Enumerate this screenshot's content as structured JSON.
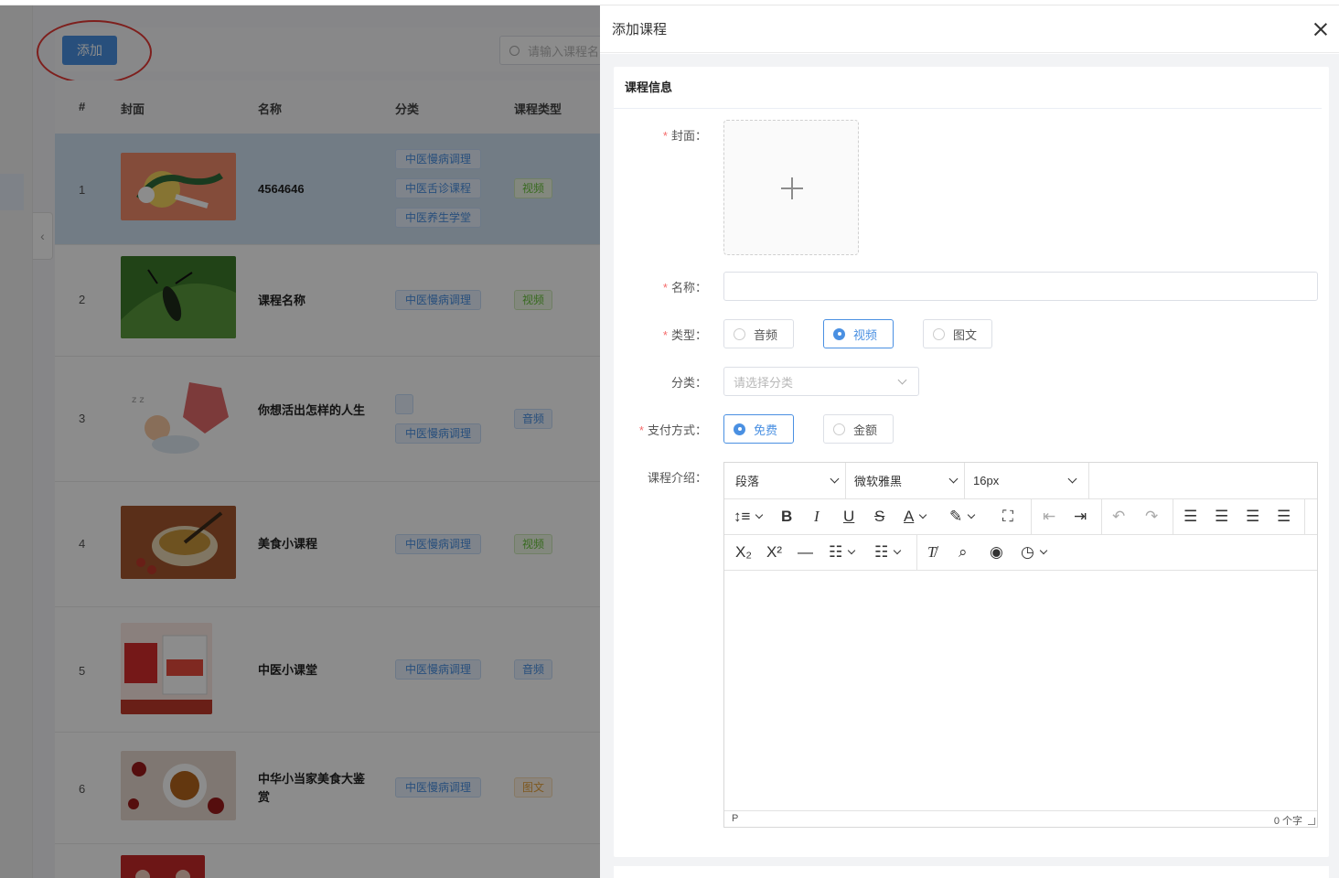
{
  "page": {
    "add_button": "添加",
    "search_placeholder": "请输入课程名",
    "columns": [
      "#",
      "封面",
      "名称",
      "分类",
      "课程类型"
    ],
    "rows": [
      {
        "index": "1",
        "name": "4564646",
        "tags": [
          "中医慢病调理",
          "中医舌诊课程",
          "中医养生学堂"
        ],
        "type": "视频",
        "type_kind": "video",
        "cover": "orange-illustration",
        "selected": true
      },
      {
        "index": "2",
        "name": "课程名称",
        "tags": [
          "中医慢病调理"
        ],
        "type": "视频",
        "type_kind": "video",
        "cover": "green-beetle-photo"
      },
      {
        "index": "3",
        "name": "你想活出怎样的人生",
        "tags": [
          "",
          "中医慢病调理"
        ],
        "type": "音频",
        "type_kind": "audio",
        "cover": "sleeping-child-illustration"
      },
      {
        "index": "4",
        "name": "美食小课程",
        "tags": [
          "中医慢病调理"
        ],
        "type": "视频",
        "type_kind": "video",
        "cover": "soup-bowl-photo"
      },
      {
        "index": "5",
        "name": "中医小课堂",
        "tags": [
          "中医慢病调理"
        ],
        "type": "音频",
        "type_kind": "audio",
        "cover": "product-poster"
      },
      {
        "index": "6",
        "name": "中华小当家美食大鉴赏",
        "tags": [
          "中医慢病调理"
        ],
        "type": "图文",
        "type_kind": "text",
        "cover": "tea-dates-photo"
      }
    ]
  },
  "drawer": {
    "title": "添加课程",
    "section_title": "课程信息",
    "fields": {
      "cover_label": "封面：",
      "name_label": "名称：",
      "type_label": "类型：",
      "category_label": "分类：",
      "payment_label": "支付方式：",
      "intro_label": "课程介绍："
    },
    "type_options": [
      {
        "label": "音频",
        "checked": false
      },
      {
        "label": "视频",
        "checked": true
      },
      {
        "label": "图文",
        "checked": false
      }
    ],
    "category_placeholder": "请选择分类",
    "payment_options": [
      {
        "label": "免费",
        "checked": true
      },
      {
        "label": "金额",
        "checked": false
      }
    ],
    "editor": {
      "paragraph": "段落",
      "font": "微软雅黑",
      "size": "16px",
      "status_tag": "P",
      "word_count": "0 个字"
    }
  },
  "colors": {
    "primary": "#4a90e2",
    "required": "#f56c6c",
    "highlight_circle": "#e53935"
  }
}
